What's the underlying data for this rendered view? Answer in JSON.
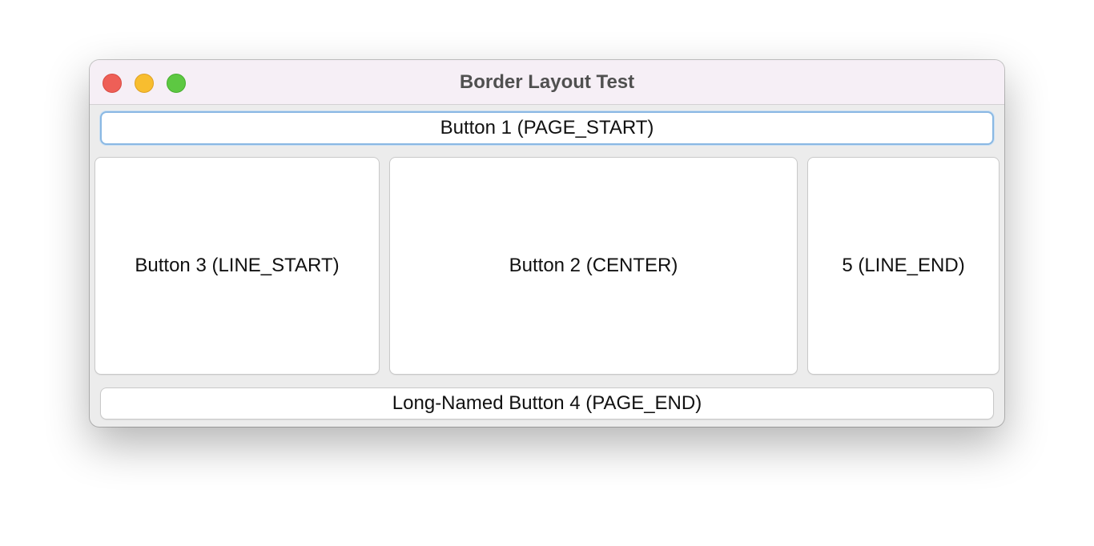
{
  "window": {
    "title": "Border Layout Test"
  },
  "buttons": {
    "page_start": "Button 1 (PAGE_START)",
    "line_start": "Button 3 (LINE_START)",
    "center": "Button 2 (CENTER)",
    "line_end": "5 (LINE_END)",
    "page_end": "Long-Named Button 4 (PAGE_END)"
  },
  "colors": {
    "titlebar": "#f6eff6",
    "close": "#ee5f57",
    "minimize": "#f8bd2f",
    "zoom": "#5dc842",
    "focus_ring": "#8ab8e3"
  }
}
